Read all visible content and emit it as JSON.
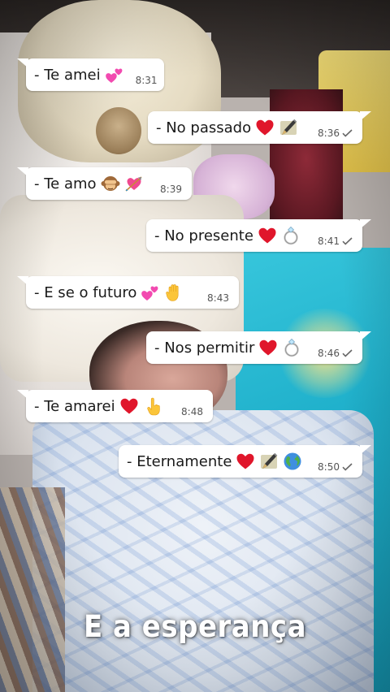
{
  "messages": [
    {
      "text": "- Te amei",
      "time": "8:31",
      "direction": "received",
      "emojis": [
        "two-hearts-icon"
      ]
    },
    {
      "text": "- No passado",
      "time": "8:36",
      "direction": "sent",
      "read": true,
      "emojis": [
        "red-heart-icon",
        "pen-icon"
      ]
    },
    {
      "text": "- Te amo",
      "time": "8:39",
      "direction": "received",
      "emojis": [
        "see-no-evil-monkey-icon",
        "heart-with-arrow-icon"
      ]
    },
    {
      "text": "- No presente",
      "time": "8:41",
      "direction": "sent",
      "read": true,
      "emojis": [
        "red-heart-icon",
        "ring-icon"
      ]
    },
    {
      "text": "- E se o futuro",
      "time": "8:43",
      "direction": "received",
      "emojis": [
        "two-hearts-icon",
        "raised-hand-icon"
      ]
    },
    {
      "text": "- Nos permitir",
      "time": "8:46",
      "direction": "sent",
      "read": true,
      "emojis": [
        "red-heart-icon",
        "ring-icon"
      ]
    },
    {
      "text": "- Te amarei",
      "time": "8:48",
      "direction": "received",
      "emojis": [
        "red-heart-icon",
        "pointing-up-icon"
      ]
    },
    {
      "text": "- Eternamente",
      "time": "8:50",
      "direction": "sent",
      "read": true,
      "emojis": [
        "red-heart-icon",
        "pen-icon",
        "globe-icon"
      ]
    }
  ],
  "caption": "E a esperança",
  "colors": {
    "bubble": "#ffffff",
    "text": "#1a1a1a",
    "meta": "#555555",
    "caption": "#ffffff"
  }
}
